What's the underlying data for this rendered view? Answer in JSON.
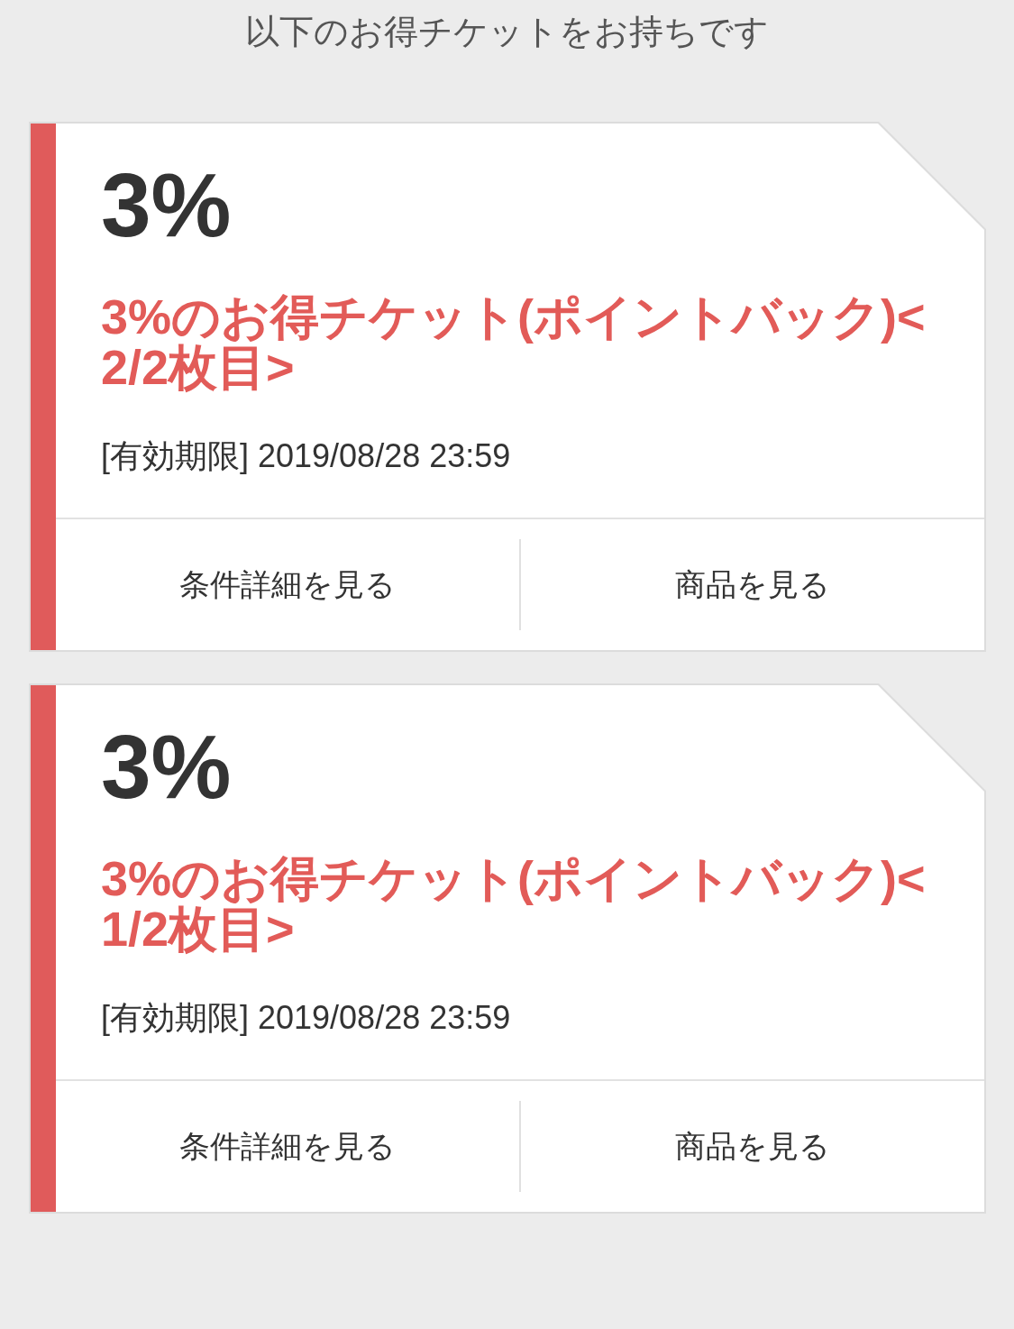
{
  "header": {
    "text": "以下のお得チケットをお持ちです"
  },
  "tickets": [
    {
      "rate": "3%",
      "title": "3%のお得チケット(ポイントバック)<2/2枚目>",
      "expiry": "[有効期限] 2019/08/28 23:59",
      "actions": [
        "条件詳細を見る",
        "商品を見る"
      ]
    },
    {
      "rate": "3%",
      "title": "3%のお得チケット(ポイントバック)<1/2枚目>",
      "expiry": "[有効期限] 2019/08/28 23:59",
      "actions": [
        "条件詳細を見る",
        "商品を見る"
      ]
    }
  ]
}
